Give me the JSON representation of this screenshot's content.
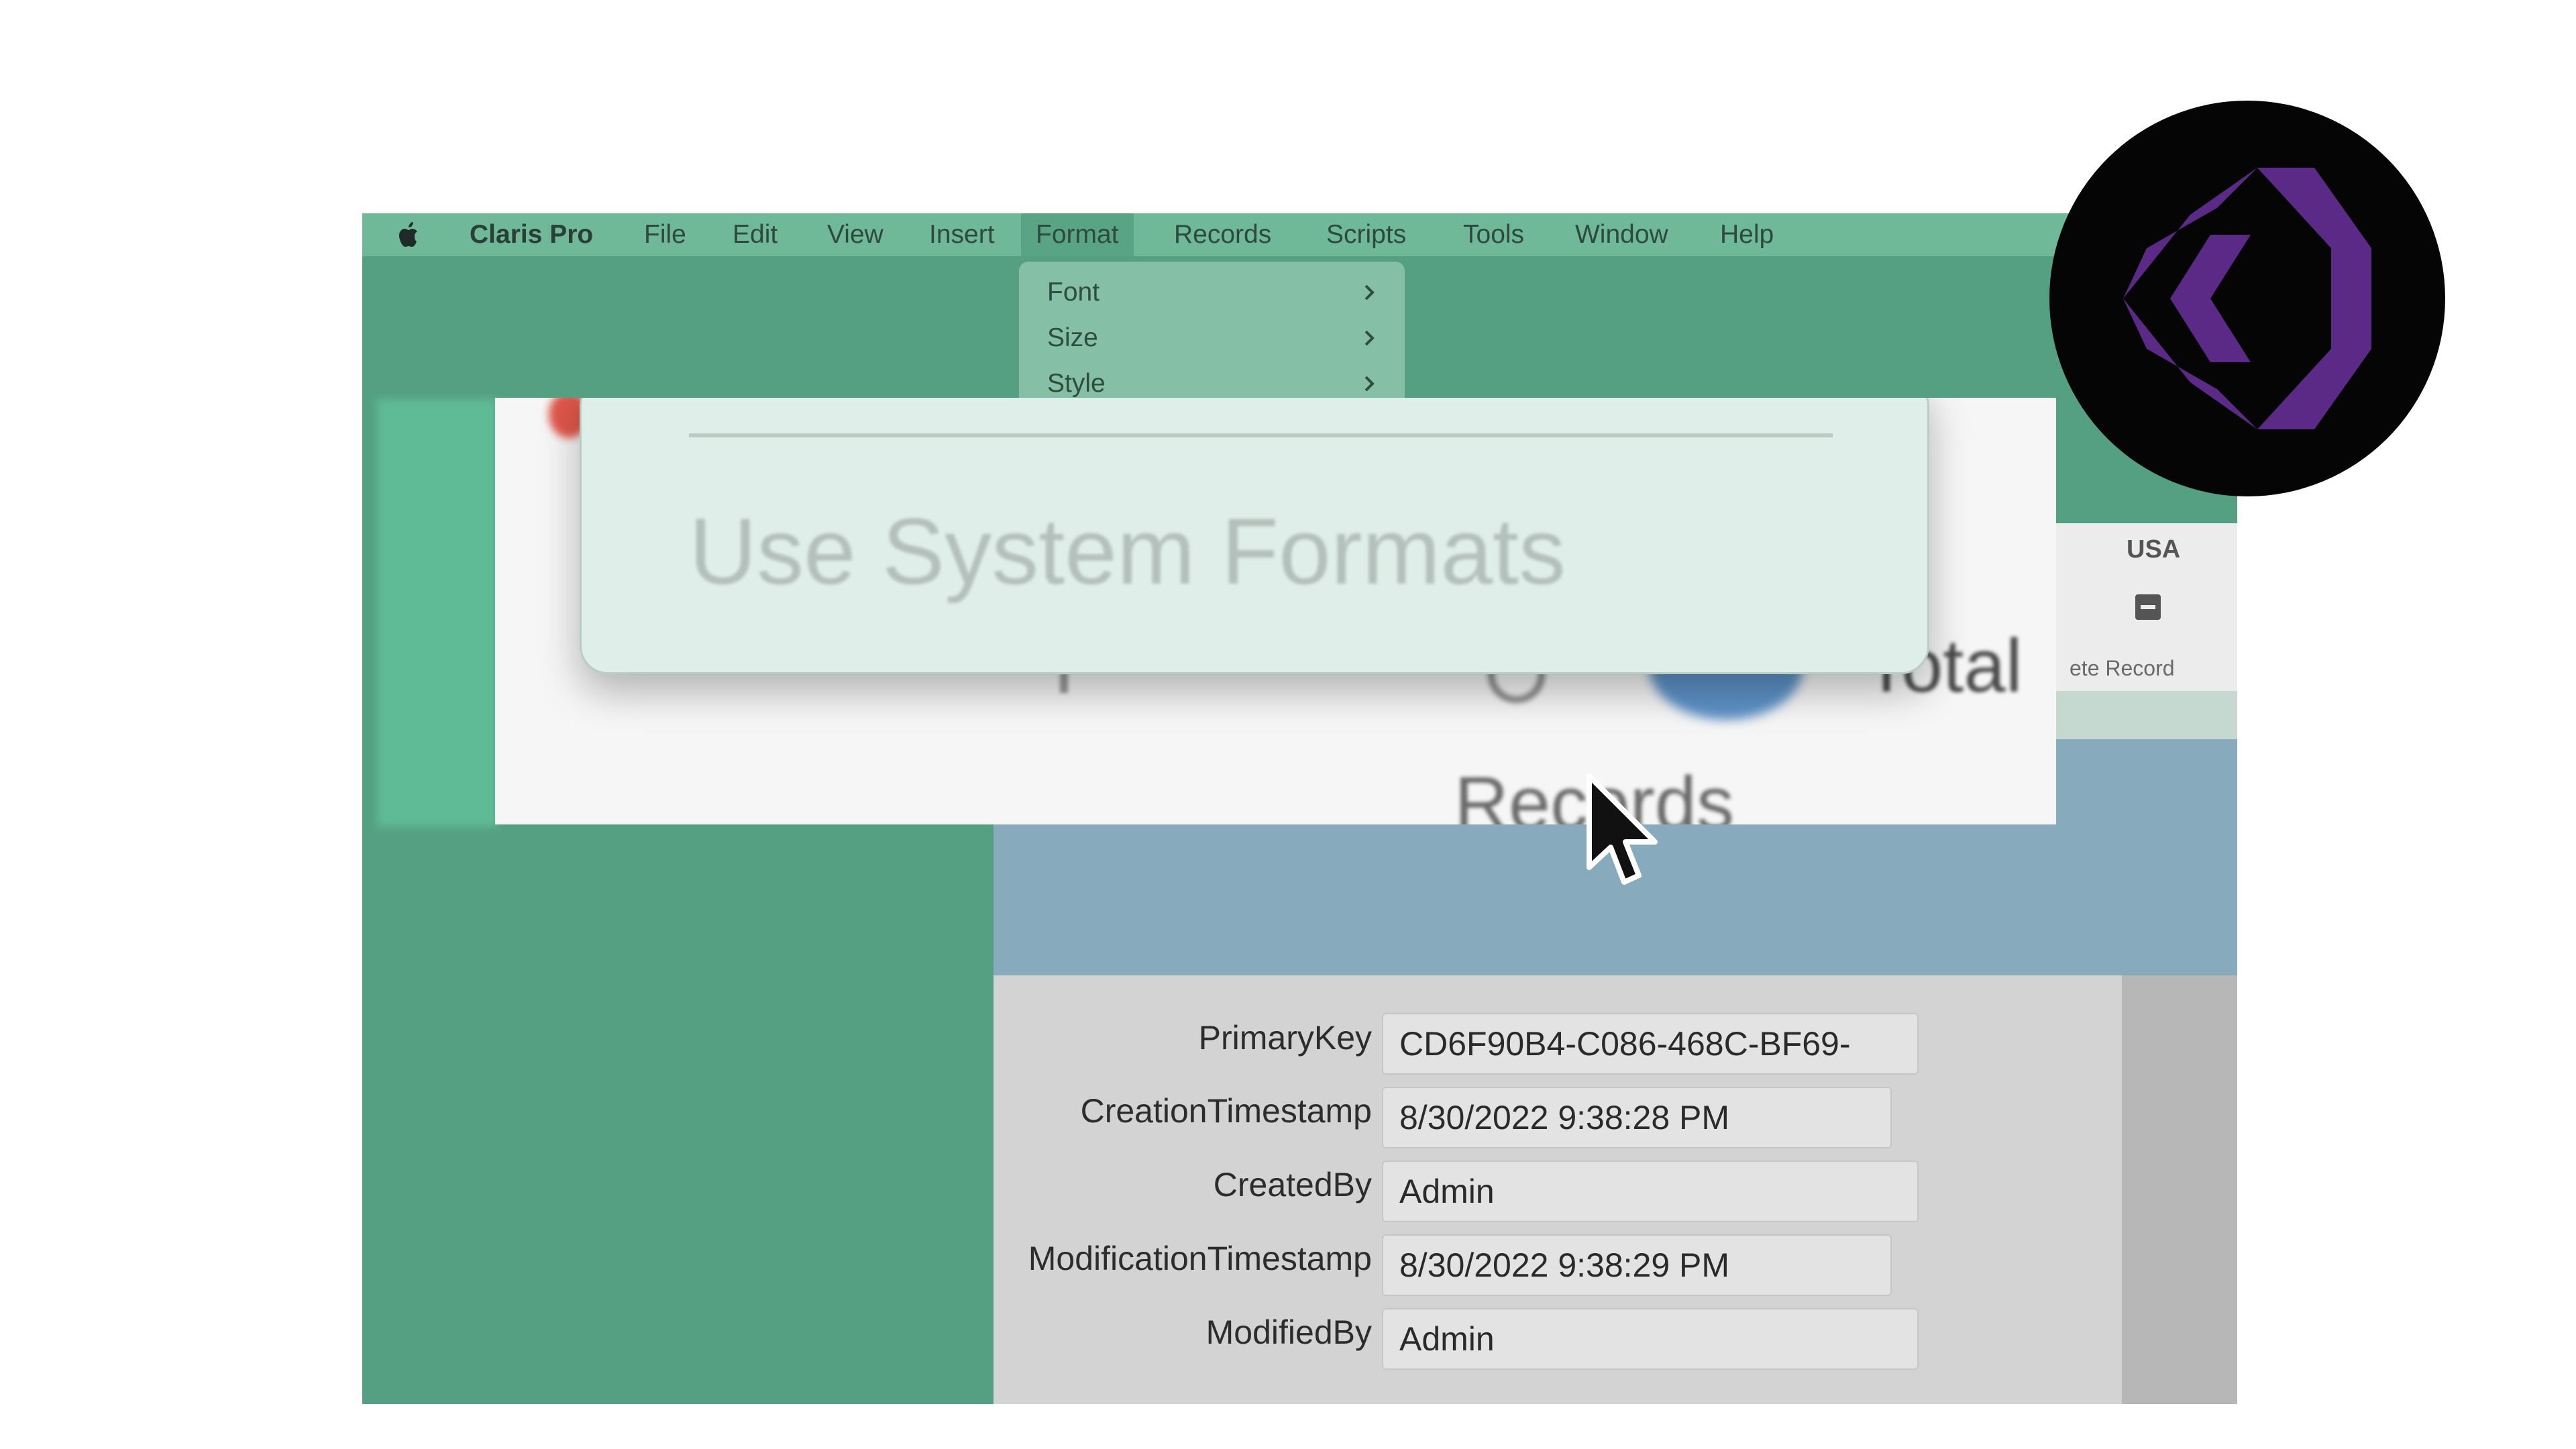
{
  "menubar": {
    "app_name": "Claris Pro",
    "items": [
      "File",
      "Edit",
      "View",
      "Insert",
      "Format",
      "Records",
      "Scripts",
      "Tools",
      "Window",
      "Help"
    ],
    "active": "Format"
  },
  "format_menu": {
    "items": [
      {
        "label": "Font",
        "icon": "chevron-right-icon"
      },
      {
        "label": "Size",
        "icon": "chevron-right-icon"
      },
      {
        "label": "Style",
        "icon": "chevron-right-icon"
      }
    ]
  },
  "zoom_callout": {
    "menu_item": "Use System Formats",
    "background_text_1": "Total",
    "background_text_2": "Records"
  },
  "toolbar": {
    "region_label": "USA",
    "delete_record_partial": "ete Record",
    "delete_icon": "minus-square-icon"
  },
  "fields": [
    {
      "label": "PrimaryKey",
      "value": "CD6F90B4-C086-468C-BF69-"
    },
    {
      "label": "CreationTimestamp",
      "value": "8/30/2022 9:38:28 PM"
    },
    {
      "label": "CreatedBy",
      "value": "Admin"
    },
    {
      "label": "ModificationTimestamp",
      "value": "8/30/2022 9:38:29 PM"
    },
    {
      "label": "ModifiedBy",
      "value": "Admin"
    }
  ],
  "colors": {
    "menubar": "#6fb898",
    "window_bg": "#55a083",
    "logo_purple": "#5b2a86"
  }
}
